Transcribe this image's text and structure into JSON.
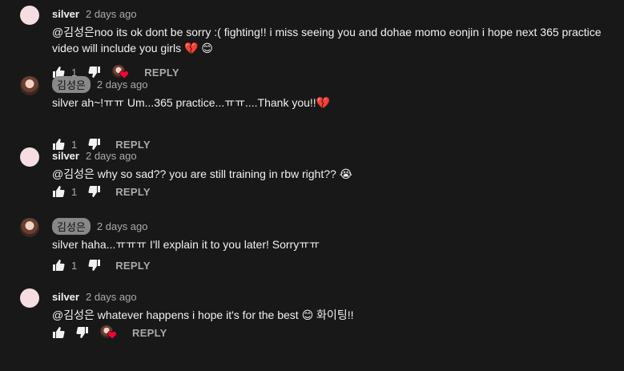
{
  "comments": [
    {
      "author": "silver",
      "time": "2 days ago",
      "text": "@김성은noo its ok dont be sorry :( fighting!! i miss seeing you and dohae momo eonjin i hope next 365 practice video will include you girls 💔 😊",
      "likes": "1",
      "reply_label": "REPLY",
      "creator_heart": true
    },
    {
      "author": "김성은",
      "time": "2 days ago",
      "text": "silver ah~!ㅠㅠ Um...365 practice...ㅠㅠ....Thank you!!💔",
      "likes": "1",
      "reply_label": "REPLY",
      "creator_heart": false
    },
    {
      "author": "silver",
      "time": "2 days ago",
      "text": "@김성은 why so sad?? you are still training in rbw right?? 😭",
      "likes": "1",
      "reply_label": "REPLY",
      "creator_heart": false
    },
    {
      "author": "김성은",
      "time": "2 days ago",
      "text": "silver haha...ㅠㅠㅠ I'll explain it to you later! Sorryㅠㅠ",
      "likes": "1",
      "reply_label": "REPLY",
      "creator_heart": false
    },
    {
      "author": "silver",
      "time": "2 days ago",
      "text": "@김성은 whatever happens i hope it's for the best 😊 화이팅!!",
      "likes": "",
      "reply_label": "REPLY",
      "creator_heart": true
    }
  ],
  "icons": {
    "like": "thumbs-up-icon",
    "dislike": "thumbs-down-icon",
    "heart": "creator-heart-icon"
  },
  "colors": {
    "background": "#181818",
    "text": "#f1f1f1",
    "secondary": "#aaaaaa",
    "heart": "#ff0033",
    "creator_chip": "#888888"
  }
}
